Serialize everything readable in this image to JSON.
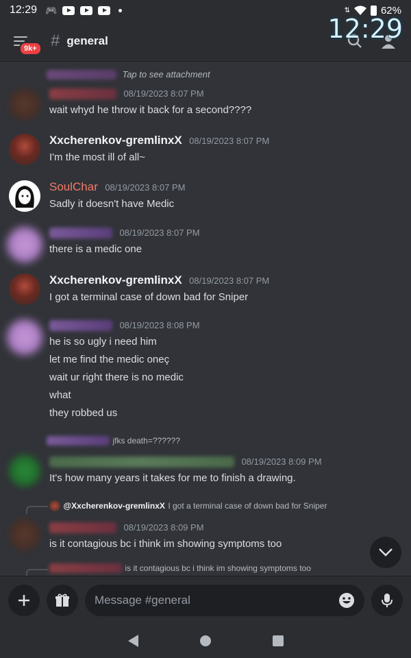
{
  "status_bar": {
    "time": "12:29",
    "battery": "62%"
  },
  "header": {
    "badge": "9k+",
    "hash": "#",
    "channel": "general",
    "clock_overlay": "12:29"
  },
  "messages": [
    {
      "id": "m1",
      "author_visible": false,
      "content": "Tap to see attachment"
    },
    {
      "id": "m2",
      "author_visible": false,
      "timestamp": "08/19/2023 8:07 PM",
      "content": "wait whyd he throw it back for a second????"
    },
    {
      "id": "m3",
      "author": "Xxcherenkov-gremlinxX",
      "timestamp": "08/19/2023 8:07 PM",
      "content": "I'm the most ill of all~"
    },
    {
      "id": "m4",
      "author": "SoulChar",
      "author_color": "#f47b67",
      "timestamp": "08/19/2023 8:07 PM",
      "content": "Sadly it doesn't have Medic"
    },
    {
      "id": "m5",
      "author_visible": false,
      "timestamp": "08/19/2023 8:07 PM",
      "content": "there is a medic one"
    },
    {
      "id": "m6",
      "author": "Xxcherenkov-gremlinxX",
      "timestamp": "08/19/2023 8:07 PM",
      "content": "I got a terminal case of down bad for Sniper"
    },
    {
      "id": "m7",
      "author_visible": false,
      "timestamp": "08/19/2023 8:08 PM",
      "lines": [
        "he is so ugly i need him",
        "let me find the medic oneç",
        "wait ur right there is no medic",
        "what",
        "they robbed us"
      ]
    },
    {
      "id": "m8",
      "reply_snippet": "jfks death=??????",
      "author_visible": false,
      "timestamp": "08/19/2023 8:09 PM",
      "content": "It's how many years it takes for me to finish a drawing."
    },
    {
      "id": "m9",
      "reply_author": "@Xxcherenkov-gremlinxX",
      "reply_snippet": "I got a terminal case of down bad for Sniper",
      "author_visible": false,
      "timestamp": "08/19/2023 8:09 PM",
      "content": "is it contagious bc i think im showing symptoms too"
    },
    {
      "id": "m10",
      "reply_snippet": "is it contagious bc i think im showing symptoms too"
    }
  ],
  "composer": {
    "placeholder": "Message #general"
  },
  "icons": {
    "menu": "hamburger-icon",
    "search": "search-icon",
    "members": "members-icon",
    "add": "plus-icon",
    "gift": "gift-icon",
    "emoji": "emoji-icon",
    "mic": "microphone-icon",
    "scroll_down": "chevron-down-icon"
  },
  "colors": {
    "background": "#313338",
    "header": "#2b2d31",
    "badge": "#f23f42",
    "soulchar": "#f47b67"
  }
}
